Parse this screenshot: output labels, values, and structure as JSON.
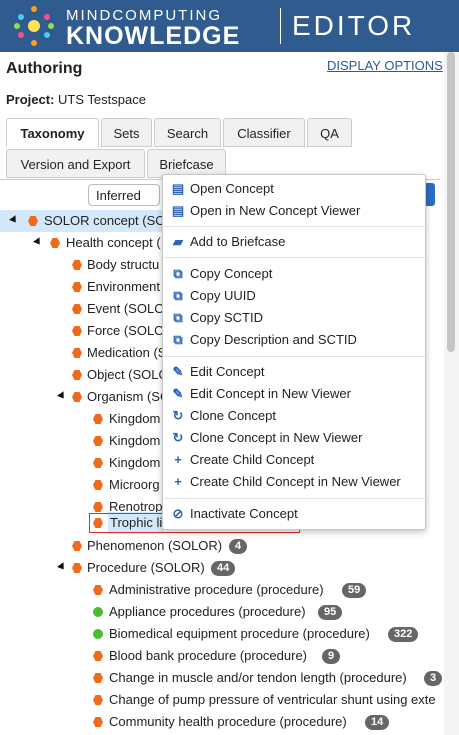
{
  "header": {
    "brand_top": "MINDCOMPUTING",
    "brand_bottom": "KNOWLEDGE",
    "product": "EDITOR"
  },
  "authoring": {
    "title": "Authoring",
    "display_options": "DISPLAY OPTIONS",
    "project_label": "Project:",
    "project_name": "UTS Testspace"
  },
  "tabs": [
    "Taxonomy",
    "Sets",
    "Search",
    "Classifier",
    "QA",
    "Version and Export",
    "Briefcase"
  ],
  "view_select": {
    "value": "Inferred"
  },
  "tree": [
    {
      "label": "SOLOR concept (SOL",
      "badge": ""
    },
    {
      "label": "Health concept (",
      "badge": ""
    },
    {
      "label": "Body structu",
      "badge": ""
    },
    {
      "label": "Environment",
      "badge": ""
    },
    {
      "label": "Event (SOLO",
      "badge": ""
    },
    {
      "label": "Force (SOLO",
      "badge": ""
    },
    {
      "label": "Medication (S",
      "badge": ""
    },
    {
      "label": "Object (SOLO",
      "badge": ""
    },
    {
      "label": "Organism (SO",
      "badge": ""
    },
    {
      "label": "Kingdom",
      "badge": ""
    },
    {
      "label": "Kingdom",
      "badge": ""
    },
    {
      "label": "Kingdom",
      "badge": ""
    },
    {
      "label": "Microorg",
      "badge": ""
    },
    {
      "label": "Renotrop",
      "badge": ""
    },
    {
      "label": "Trophic li",
      "badge": ""
    },
    {
      "label": "Phenomenon (SOLOR)",
      "badge": "4"
    },
    {
      "label": "Procedure (SOLOR)",
      "badge": "44"
    },
    {
      "label": "Administrative procedure (procedure)",
      "badge": "59"
    },
    {
      "label": "Appliance procedures (procedure)",
      "badge": "95"
    },
    {
      "label": "Biomedical equipment procedure (procedure)",
      "badge": "322"
    },
    {
      "label": "Blood bank procedure (procedure)",
      "badge": "9"
    },
    {
      "label": "Change in muscle and/or tendon length (procedure)",
      "badge": "3"
    },
    {
      "label": "Change of pump pressure of ventricular shunt using exte",
      "badge": ""
    },
    {
      "label": "Community health procedure (procedure)",
      "badge": "14"
    }
  ],
  "context_menu": {
    "items": [
      {
        "label": "Open Concept",
        "icon": "list-icon"
      },
      {
        "label": "Open in New Concept Viewer",
        "icon": "list-icon"
      },
      {
        "label": "Add to Briefcase",
        "icon": "briefcase-icon"
      },
      {
        "label": "Copy Concept",
        "icon": "copy-icon"
      },
      {
        "label": "Copy UUID",
        "icon": "copy-icon"
      },
      {
        "label": "Copy SCTID",
        "icon": "copy-icon"
      },
      {
        "label": "Copy Description and SCTID",
        "icon": "copy-icon"
      },
      {
        "label": "Edit Concept",
        "icon": "pencil-icon"
      },
      {
        "label": "Edit Concept in New Viewer",
        "icon": "pencil-icon"
      },
      {
        "label": "Clone Concept",
        "icon": "clone-icon"
      },
      {
        "label": "Clone Concept in New Viewer",
        "icon": "clone-icon"
      },
      {
        "label": "Create Child Concept",
        "icon": "plus-icon"
      },
      {
        "label": "Create Child Concept in New Viewer",
        "icon": "plus-icon"
      },
      {
        "label": "Inactivate Concept",
        "icon": "ban-icon"
      }
    ]
  },
  "colors": {
    "header": "#2f5b8e",
    "orange": "#ef6a1b",
    "green": "#4bbc2f",
    "highlight": "#d4e8fb",
    "accent": "#2d6cc4"
  }
}
